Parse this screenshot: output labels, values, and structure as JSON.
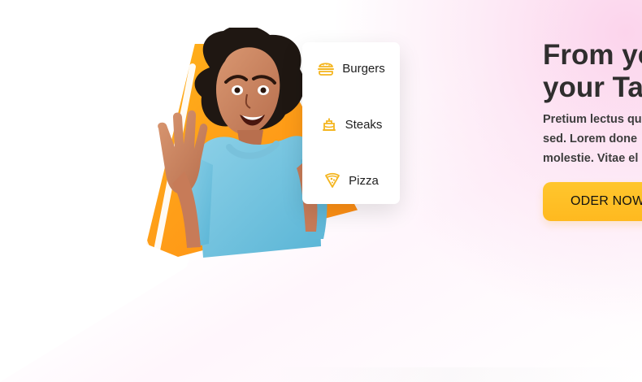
{
  "hero": {
    "title": "From yo\nyour Ta",
    "description": "Pretium lectus qu\nsed. Lorem done\nmolestie. Vitae el",
    "button_label": "ODER NOW"
  },
  "menu": {
    "items": [
      {
        "label": "Burgers",
        "icon": "burger-icon"
      },
      {
        "label": "Steaks",
        "icon": "cake-icon"
      },
      {
        "label": "Pizza",
        "icon": "pizza-slice-icon"
      }
    ]
  },
  "colors": {
    "accent_orange": "#ff9f18",
    "button_yellow": "#ffc62d",
    "icon_yellow": "#f4b51f",
    "background_pink": "#fcd2eb",
    "text_dark": "#2f2e2e"
  }
}
